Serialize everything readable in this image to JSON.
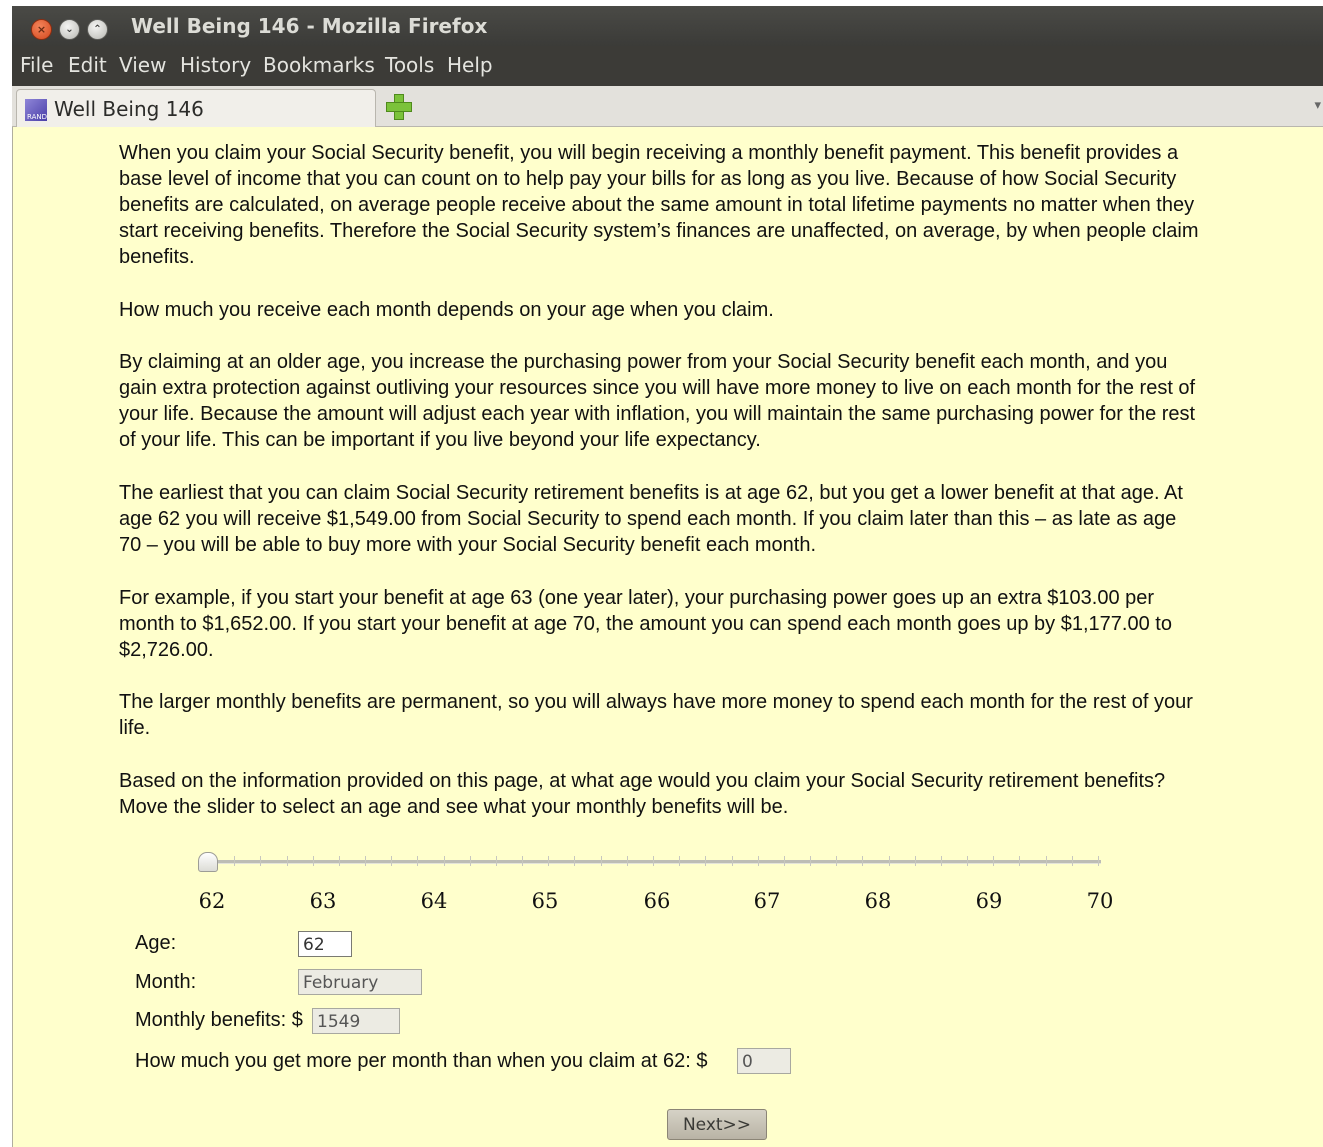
{
  "window": {
    "title": "Well Being 146 - Mozilla Firefox",
    "close_glyph": "×",
    "minimize_glyph": "⌄",
    "maximize_glyph": "⌃"
  },
  "menu": {
    "items": [
      "File",
      "Edit",
      "View",
      "History",
      "Bookmarks",
      "Tools",
      "Help"
    ]
  },
  "tabs": {
    "active_title": "Well Being 146",
    "favicon_text": "RAND",
    "new_tab_icon": "plus-icon",
    "list_arrow": "▾"
  },
  "content": {
    "paragraphs": [
      "When you claim your Social Security benefit, you will begin receiving a monthly benefit payment. This benefit provides a base level of income that you can count on to help pay your bills for as long as you live. Because of how Social Security benefits are calculated, on average people receive about the same amount in total lifetime payments no matter when they start receiving benefits. Therefore the Social Security system’s finances are unaffected, on average, by when people claim benefits.",
      "How much you receive each month depends on your age when you claim.",
      "By claiming at an older age, you increase the purchasing power from your Social Security benefit each month, and you gain extra protection against outliving your resources since you will have more money to live on each month for the rest of your life. Because the amount will adjust each year with inflation, you will maintain the same purchasing power for the rest of your life. This can be important if you live beyond your life expectancy.",
      "The earliest that you can claim Social Security retirement benefits is at age 62, but you get a lower benefit at that age. At age 62 you will receive $1,549.00 from Social Security to spend each month. If you claim later than this – as late as age 70 – you will be able to buy more with your Social Security benefit each month.",
      "For example, if you start your benefit at age 63 (one year later), your purchasing power goes up an extra $103.00 per month to $1,652.00. If you start your benefit at age 70, the amount you can spend each month goes up by $1,177.00 to $2,726.00.",
      "The larger monthly benefits are permanent, so you will always have more money to spend each month for the rest of your life.",
      "Based on the information provided on this page, at what age would you claim your Social Security retirement benefits? Move the slider to select an age and see what your monthly benefits will be."
    ]
  },
  "slider": {
    "labels": [
      "62",
      "63",
      "64",
      "65",
      "66",
      "67",
      "68",
      "69",
      "70"
    ],
    "min": 62,
    "max": 70,
    "value": 62
  },
  "form": {
    "age_label": "Age:",
    "age_value": "62",
    "month_label": "Month:",
    "month_value": "February",
    "benefits_label": "Monthly benefits: $",
    "benefits_value": "1549",
    "more_label": "How much you get more per month than when you claim at 62: $",
    "more_value": "0",
    "next_label": "Next>>"
  }
}
